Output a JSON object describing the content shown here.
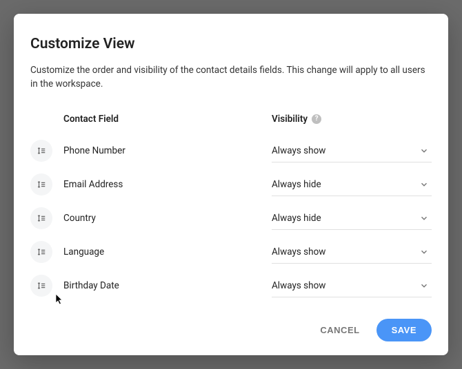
{
  "modal": {
    "title": "Customize View",
    "description": "Customize the order and visibility of the contact details fields. This change will apply to all users in the workspace.",
    "headers": {
      "field": "Contact Field",
      "visibility": "Visibility"
    },
    "fields": [
      {
        "name": "Phone Number",
        "visibility": "Always show"
      },
      {
        "name": "Email Address",
        "visibility": "Always hide"
      },
      {
        "name": "Country",
        "visibility": "Always hide"
      },
      {
        "name": "Language",
        "visibility": "Always show"
      },
      {
        "name": "Birthday Date",
        "visibility": "Always show"
      }
    ],
    "buttons": {
      "cancel": "CANCEL",
      "save": "SAVE"
    }
  }
}
